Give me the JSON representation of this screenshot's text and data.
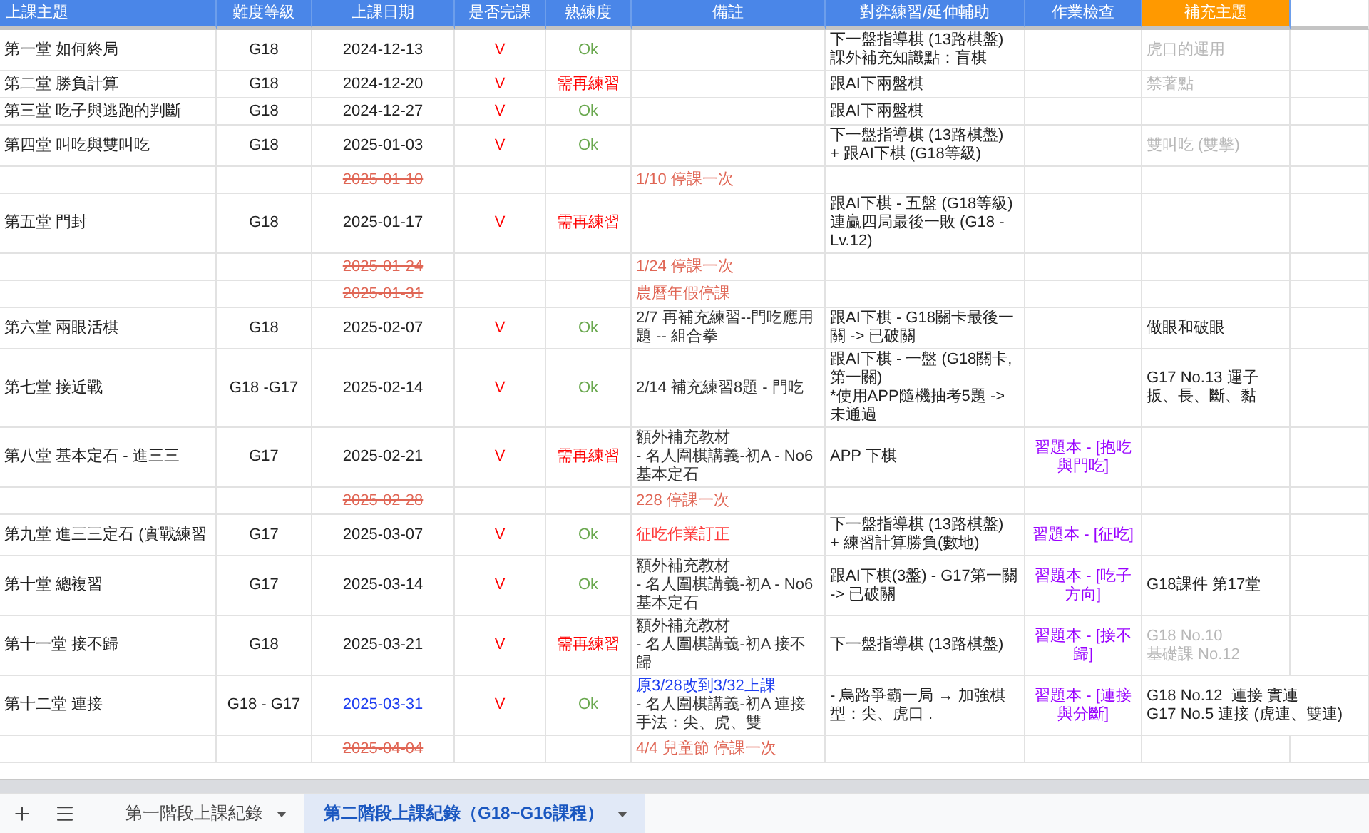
{
  "columns": [
    {
      "label": "上課主題",
      "color": "#4a86e8"
    },
    {
      "label": "難度等級",
      "color": "#4a86e8"
    },
    {
      "label": "上課日期",
      "color": "#4a86e8"
    },
    {
      "label": "是否完課",
      "color": "#4a86e8"
    },
    {
      "label": "熟練度",
      "color": "#4a86e8"
    },
    {
      "label": "備註",
      "color": "#4a86e8"
    },
    {
      "label": "對弈練習/延伸輔助",
      "color": "#4a86e8"
    },
    {
      "label": "作業檢查",
      "color": "#4a86e8"
    },
    {
      "label": "補充主題",
      "color": "#ff9900"
    }
  ],
  "rows": [
    {
      "topic": "第一堂 如何終局",
      "level": "G18",
      "date": {
        "text": "2024-12-13",
        "kind": "held"
      },
      "done": "V",
      "proficiency": {
        "text": "Ok",
        "kind": "ok"
      },
      "practice": "下一盤指導棋 (13路棋盤)\n課外補充知識點：盲棋",
      "supplement": {
        "text": "虎口的運用",
        "muted": true
      }
    },
    {
      "topic": "第二堂 勝負計算",
      "level": "G18",
      "date": {
        "text": "2024-12-20",
        "kind": "held"
      },
      "done": "V",
      "proficiency": {
        "text": "需再練習",
        "kind": "retry"
      },
      "practice": "跟AI下兩盤棋",
      "supplement": {
        "text": "禁著點",
        "muted": true
      }
    },
    {
      "topic": "第三堂 吃子與逃跑的判斷",
      "level": "G18",
      "date": {
        "text": "2024-12-27",
        "kind": "held"
      },
      "done": "V",
      "proficiency": {
        "text": "Ok",
        "kind": "ok"
      },
      "practice": "跟AI下兩盤棋"
    },
    {
      "topic": "第四堂 叫吃與雙叫吃",
      "level": "G18",
      "date": {
        "text": "2025-01-03",
        "kind": "held"
      },
      "done": "V",
      "proficiency": {
        "text": "Ok",
        "kind": "ok"
      },
      "practice": "下一盤指導棋 (13路棋盤)\n+ 跟AI下棋 (G18等級)",
      "supplement": {
        "text": "雙叫吃 (雙擊)",
        "muted": true
      }
    },
    {
      "date": {
        "text": "2025-01-10",
        "kind": "cancelled"
      },
      "note": [
        {
          "text": "1/10 停課一次",
          "kind": "cancel"
        }
      ]
    },
    {
      "topic": "第五堂 門封",
      "level": "G18",
      "date": {
        "text": "2025-01-17",
        "kind": "held"
      },
      "done": "V",
      "proficiency": {
        "text": "需再練習",
        "kind": "retry"
      },
      "practice": "跟AI下棋 - 五盤 (G18等級) 連贏四局最後一敗 (G18 - Lv.12)"
    },
    {
      "date": {
        "text": "2025-01-24",
        "kind": "cancelled"
      },
      "note": [
        {
          "text": "1/24 停課一次",
          "kind": "cancel"
        }
      ]
    },
    {
      "date": {
        "text": "2025-01-31",
        "kind": "cancelled"
      },
      "note": [
        {
          "text": "農曆年假停課",
          "kind": "cancel"
        }
      ]
    },
    {
      "topic": "第六堂 兩眼活棋",
      "level": "G18",
      "date": {
        "text": "2025-02-07",
        "kind": "held"
      },
      "done": "V",
      "proficiency": {
        "text": "Ok",
        "kind": "ok"
      },
      "note": [
        {
          "text": "2/7 再補充練習--門吃應用題 -- 組合拳",
          "kind": "normal"
        }
      ],
      "practice": "跟AI下棋 - G18關卡最後一關 -> 已破關",
      "supplement": {
        "text": "做眼和破眼",
        "muted": false
      }
    },
    {
      "topic": "第七堂 接近戰",
      "level": "G18 -G17",
      "date": {
        "text": "2025-02-14",
        "kind": "held"
      },
      "done": "V",
      "proficiency": {
        "text": "Ok",
        "kind": "ok"
      },
      "note": [
        {
          "text": "2/14 補充練習8題 - 門吃",
          "kind": "normal"
        }
      ],
      "practice": "跟AI下棋 - 一盤 (G18關卡,第一關)\n*使用APP隨機抽考5題 -> 未通過",
      "supplement": {
        "text": "G17 No.13 運子扳、長、斷、黏",
        "muted": false
      }
    },
    {
      "topic": "第八堂 基本定石 - 進三三",
      "level": "G17",
      "date": {
        "text": "2025-02-21",
        "kind": "held"
      },
      "done": "V",
      "proficiency": {
        "text": "需再練習",
        "kind": "retry"
      },
      "note": [
        {
          "text": "額外補充教材\n- 名人圍棋講義-初A - No6 基本定石",
          "kind": "normal"
        }
      ],
      "practice": "APP 下棋",
      "homework": "習題本 - [抱吃與門吃]"
    },
    {
      "date": {
        "text": "2025-02-28",
        "kind": "cancelled"
      },
      "note": [
        {
          "text": "228 停課一次",
          "kind": "cancel"
        }
      ]
    },
    {
      "topic": "第九堂 進三三定石 (實戰練習",
      "level": "G17",
      "date": {
        "text": "2025-03-07",
        "kind": "held"
      },
      "done": "V",
      "proficiency": {
        "text": "Ok",
        "kind": "ok"
      },
      "note": [
        {
          "text": "征吃作業訂正",
          "kind": "alert"
        }
      ],
      "practice": "下一盤指導棋 (13路棋盤)\n+ 練習計算勝負(數地)",
      "homework": "習題本 - [征吃]"
    },
    {
      "topic": "第十堂 總複習",
      "level": "G17",
      "date": {
        "text": "2025-03-14",
        "kind": "held"
      },
      "done": "V",
      "proficiency": {
        "text": "Ok",
        "kind": "ok"
      },
      "note": [
        {
          "text": "額外補充教材\n- 名人圍棋講義-初A - No6 基本定石",
          "kind": "normal"
        }
      ],
      "practice": "跟AI下棋(3盤) - G17第一關 -> 已破關",
      "homework": "習題本 - [吃子方向]",
      "supplement": {
        "text": "G18課件 第17堂",
        "muted": false
      }
    },
    {
      "topic": "第十一堂 接不歸",
      "level": "G18",
      "date": {
        "text": "2025-03-21",
        "kind": "held"
      },
      "done": "V",
      "proficiency": {
        "text": "需再練習",
        "kind": "retry"
      },
      "note": [
        {
          "text": "額外補充教材\n- 名人圍棋講義-初A 接不歸",
          "kind": "normal"
        }
      ],
      "practice": "下一盤指導棋 (13路棋盤)",
      "homework": "習題本 - [接不歸]",
      "supplement": {
        "text": "G18 No.10\n基礎課 No.12",
        "muted": true
      }
    },
    {
      "topic": "第十二堂 連接",
      "level": "G18 - G17",
      "date": {
        "text": "2025-03-31",
        "kind": "rescheduled"
      },
      "done": "V",
      "proficiency": {
        "text": "Ok",
        "kind": "ok"
      },
      "note": [
        {
          "text": "原3/28改到3/32上課",
          "kind": "changed"
        },
        {
          "text": "- 名人圍棋講義-初A 連接手法：尖、虎、雙",
          "kind": "normal"
        }
      ],
      "practice": "- 烏路爭霸一局 → 加強棋型：尖、虎口 .",
      "homework": "習題本 - [連接與分斷]",
      "supplement": {
        "text": "G18 No.12  連接 實連\nG17 No.5 連接 (虎連、雙連)",
        "muted": false
      }
    },
    {
      "date": {
        "text": "2025-04-04",
        "kind": "cancelled"
      },
      "note": [
        {
          "text": "4/4 兒童節 停課一次",
          "kind": "cancel"
        }
      ]
    }
  ],
  "sheet_tabs": [
    {
      "label": "第一階段上課紀錄",
      "selected": false
    },
    {
      "label": "第二階段上課紀錄（G18~G16課程）",
      "selected": true
    }
  ]
}
